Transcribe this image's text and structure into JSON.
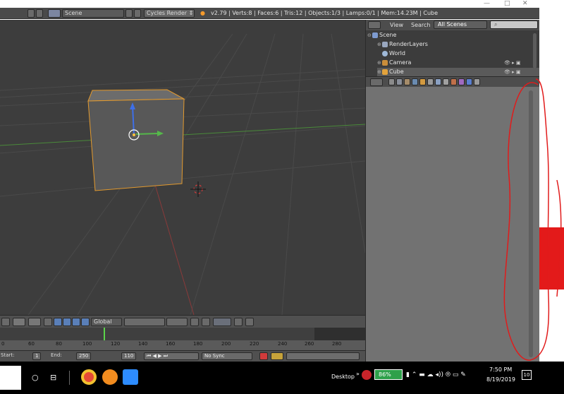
{
  "topbar": {
    "scene_label": "Scene",
    "render_engine": "Cycles Render",
    "stats": "v2.79 | Verts:8 | Faces:6 | Tris:12 | Objects:1/3 | Lamps:0/1 | Mem:14.23M | Cube"
  },
  "outliner": {
    "view": "View",
    "search": "Search",
    "scope": "All Scenes",
    "items": [
      {
        "label": "Scene",
        "color": "#7e9bd0"
      },
      {
        "label": "RenderLayers",
        "color": "#9aa8c0"
      },
      {
        "label": "World",
        "color": "#9fb9d8"
      },
      {
        "label": "Camera",
        "color": "#c98d3a"
      },
      {
        "label": "Cube",
        "color": "#e3a33c"
      }
    ]
  },
  "viewport_header": {
    "orientation": "Global"
  },
  "timeline": {
    "ticks": [
      "0",
      "60",
      "80",
      "100",
      "120",
      "140",
      "160",
      "180",
      "200",
      "220",
      "240",
      "260",
      "280"
    ],
    "start_label": "Start:",
    "start_value": "1",
    "end_label": "End:",
    "end_value": "250",
    "current_frame": "110",
    "sync": "No Sync"
  },
  "taskbar": {
    "desktop": "Desktop",
    "battery": "86%",
    "time": "7:50 PM",
    "date": "8/19/2019",
    "notif_count": "10"
  },
  "colors": {
    "selection_outline": "#e39a2e",
    "annotation": "#e11b1b",
    "x_axis": "#c54848",
    "y_axis": "#55b84a",
    "z_axis": "#3e6fe8"
  }
}
